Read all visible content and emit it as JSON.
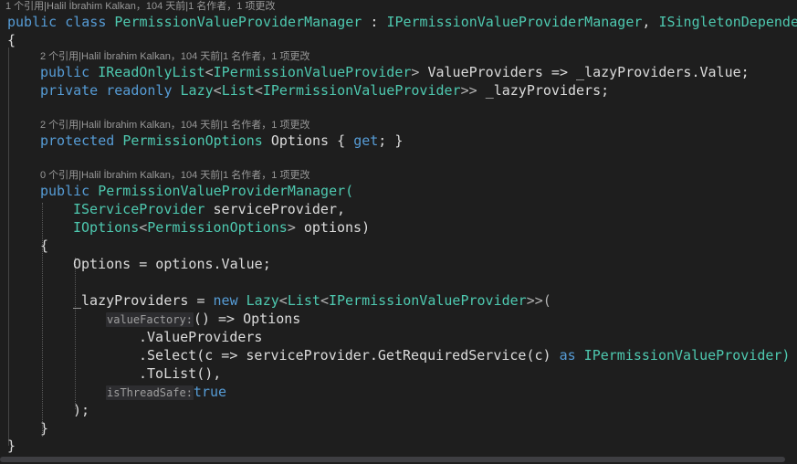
{
  "codelens": {
    "class_line": "1 个引用|Halil İbrahim Kalkan，104 天前|1 名作者，1 项更改",
    "value_providers": "2 个引用|Halil İbrahim Kalkan，104 天前|1 名作者，1 项更改",
    "options_prop": "2 个引用|Halil İbrahim Kalkan，104 天前|1 名作者，1 项更改",
    "constructor": "0 个引用|Halil İbrahim Kalkan，104 天前|1 名作者，1 项更改"
  },
  "code": {
    "kw_public": "public",
    "kw_class": "class",
    "kw_private": "private",
    "kw_readonly": "readonly",
    "kw_protected": "protected",
    "kw_get": "get",
    "kw_new": "new",
    "kw_as": "as",
    "kw_true": "true",
    "class_name": "PermissionValueProviderManager",
    "colon": " : ",
    "iface_manager": "IPermissionValueProviderManager",
    "comma_space": ", ",
    "iface_singleton": "ISingletonDependency",
    "open_brace": "{",
    "close_brace": "}",
    "ireadonlylist": "IReadOnlyList",
    "ipvp": "IPermissionValueProvider",
    "lazy": "Lazy",
    "list": "List",
    "value_providers_prop": "ValueProviders",
    "lazy_value": "_lazyProviders.Value;",
    "lazy_field": "_lazyProviders;",
    "arrow": " => ",
    "permission_options": "PermissionOptions",
    "options_prop": "Options",
    "get_accessor": " { get; }",
    "ctor_name": "PermissionValueProviderManager(",
    "iserviceprovider": "IServiceProvider",
    "param_sp": " serviceProvider,",
    "ioptions": "IOptions",
    "param_options": " options)",
    "assign_options": "Options = options.Value;",
    "lazy_assign": "_lazyProviders = ",
    "value_factory_hint": "valueFactory:",
    "lambda_start": "() => Options",
    "dot_value_providers": ".ValueProviders",
    "select_start": ".Select(c => serviceProvider.GetRequiredService(c) ",
    "select_end": " IPermissionValueProvider)",
    "to_list": ".ToList(),",
    "thread_safe_hint": "isThreadSafe:",
    "close_paren": ");"
  }
}
